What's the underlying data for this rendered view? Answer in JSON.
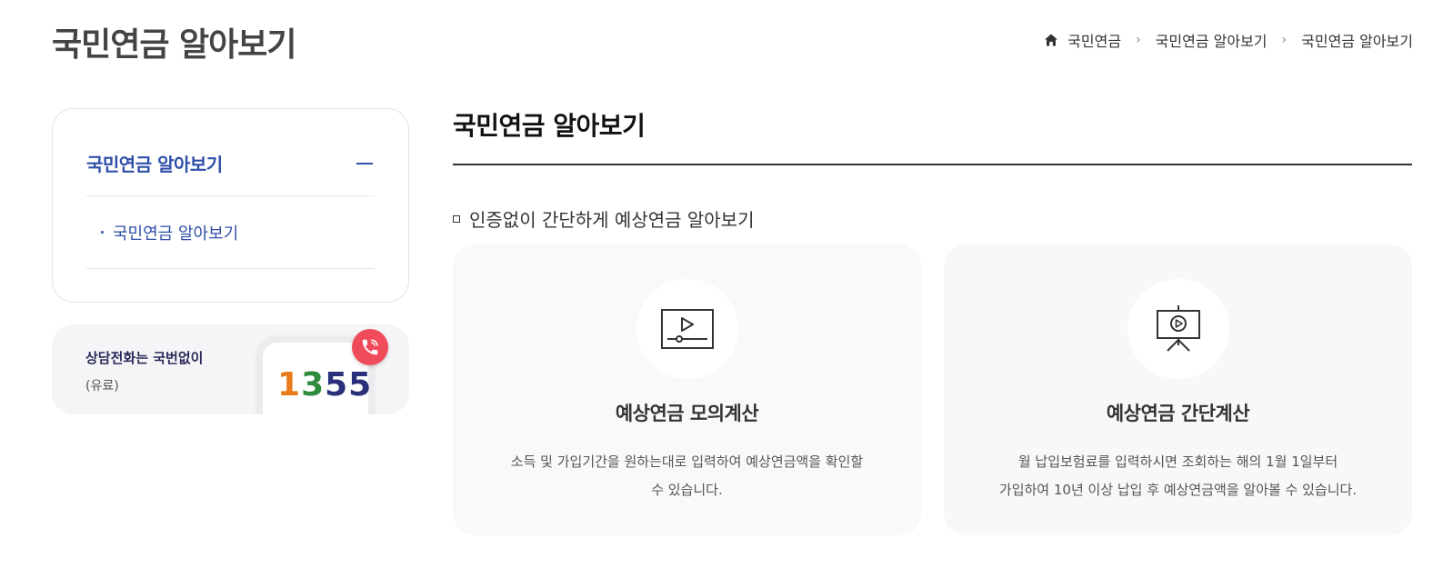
{
  "header": {
    "title": "국민연금 알아보기"
  },
  "breadcrumb": {
    "icon": "home-icon",
    "items": [
      "국민연금",
      "국민연금 알아보기",
      "국민연금 알아보기"
    ],
    "separator": "›"
  },
  "sidebar": {
    "title": "국민연금 알아보기",
    "toggle_icon": "minus-icon",
    "items": [
      {
        "label": "국민연금 알아보기"
      }
    ]
  },
  "call_banner": {
    "text": "상담전화는 국번없이",
    "note": "(유료)",
    "number_parts": [
      "1",
      "3",
      "55"
    ],
    "icon": "phone-call-icon",
    "colors": {
      "badge": "#ef4b5a",
      "digit1": "#e87b1a",
      "digit2": "#2e8a3c",
      "digit3": "#2a2f7a"
    }
  },
  "main": {
    "title": "국민연금 알아보기",
    "subheading": "인증없이 간단하게 예상연금 알아보기",
    "cards": [
      {
        "icon": "video-player-icon",
        "title": "예상연금 모의계산",
        "desc_line1": "소득 및 가입기간을 원하는대로 입력하여 예상연금액을 확인할",
        "desc_line2": "수 있습니다."
      },
      {
        "icon": "presentation-screen-icon",
        "title": "예상연금 간단계산",
        "desc_line1": "월 납입보험료를 입력하시면 조회하는 해의 1월 1일부터",
        "desc_line2": "가입하여 10년 이상 납입 후 예상연금액을 알아볼 수 있습니다."
      }
    ]
  },
  "colors": {
    "accent": "#2f4fa8"
  }
}
